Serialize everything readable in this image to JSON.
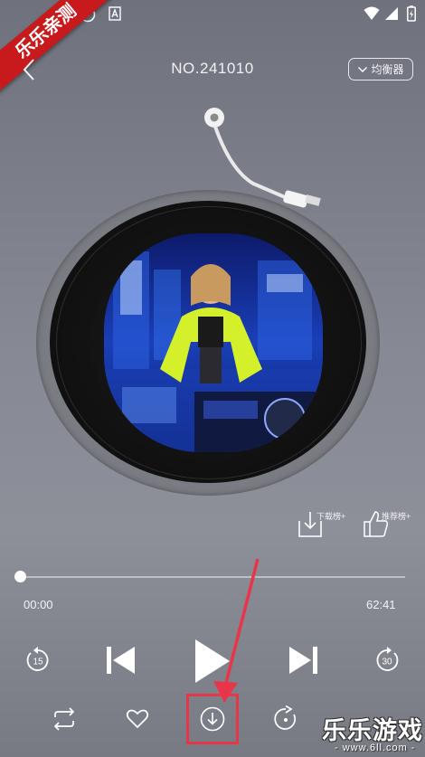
{
  "header": {
    "title": "NO.241010",
    "equalizer_label": "均衡器"
  },
  "ranks": {
    "download_label": "下载榜+",
    "recommend_label": "推荐榜+"
  },
  "player": {
    "current_time": "00:00",
    "total_time": "62:41",
    "progress": 0.0,
    "rewind_seconds": "15",
    "forward_seconds": "30"
  },
  "watermark": {
    "ribbon_text": "乐乐亲测",
    "brand_name": "乐乐游戏",
    "brand_url": "- www.6ll.com -"
  },
  "colors": {
    "accent_annotation": "#e8354a",
    "ribbon": "#c8191c"
  },
  "icons": [
    "back-icon",
    "equalizer-chevron-icon",
    "download-rank-icon",
    "thumbs-up-icon",
    "rewind-15-icon",
    "previous-icon",
    "play-icon",
    "next-icon",
    "forward-30-icon",
    "repeat-icon",
    "heart-icon",
    "download-icon",
    "share-icon"
  ]
}
